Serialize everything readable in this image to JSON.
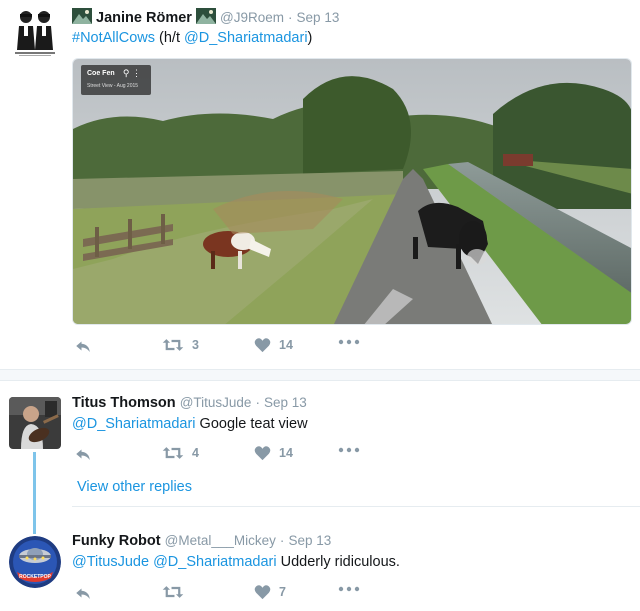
{
  "tweet1": {
    "name": "Janine Römer",
    "handle": "@J9Roem",
    "separator": "·",
    "date": "Sep 13",
    "hashtag": "#NotAllCows",
    "text_pre": " (h/t ",
    "mention": "@D_Shariatmadari",
    "text_post": ")",
    "media": {
      "sv_title": "Coe Fen",
      "sv_sub": "Street View - Aug 2015"
    },
    "retweets": "3",
    "likes": "14"
  },
  "tweet2": {
    "name": "Titus Thomson",
    "handle": "@TitusJude",
    "separator": "·",
    "date": "Sep 13",
    "mention": "@D_Shariatmadari",
    "text": " Google teat view",
    "retweets": "4",
    "likes": "14"
  },
  "view_other_replies": "View other replies",
  "tweet3": {
    "name": "Funky Robot",
    "handle": "@Metal___Mickey",
    "separator": "·",
    "date": "Sep 13",
    "mention1": "@TitusJude",
    "mention2": "@D_Shariatmadari",
    "text": " Udderly ridiculous.",
    "likes": "7"
  },
  "colors": {
    "link": "#1b95e0",
    "muted": "#8899a6",
    "thread": "#7ec4ea"
  },
  "icons": [
    "reply-icon",
    "retweet-icon",
    "like-icon",
    "more-icon",
    "mountain-icon"
  ]
}
